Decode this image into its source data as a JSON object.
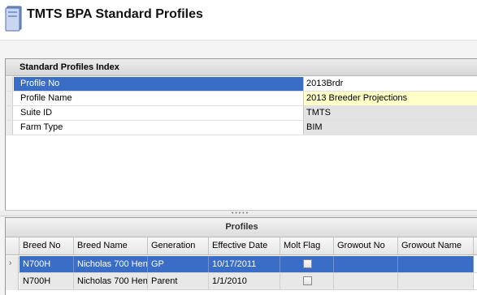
{
  "header": {
    "title": "TMTS BPA Standard Profiles",
    "icon": "profile-book-icon"
  },
  "index": {
    "heading": "Standard Profiles Index",
    "rows": [
      {
        "label": "Profile No",
        "value": "2013Brdr"
      },
      {
        "label": "Profile Name",
        "value": "2013 Breeder Projections"
      },
      {
        "label": "Suite ID",
        "value": "TMTS"
      },
      {
        "label": "Farm Type",
        "value": "BIM"
      }
    ],
    "selected_row": "Profile No"
  },
  "grid": {
    "group_title": "Profiles",
    "columns": [
      "Breed No",
      "Breed Name",
      "Generation",
      "Effective Date",
      "Molt Flag",
      "Growout No",
      "Growout Name"
    ],
    "rows": [
      {
        "breed_no": "N700H",
        "breed_name": "Nicholas 700 Hen",
        "generation": "GP",
        "effective_date": "10/17/2011",
        "molt_flag": false,
        "growout_no": "",
        "growout_name": "",
        "selected": true
      },
      {
        "breed_no": "N700H",
        "breed_name": "Nicholas 700 Hen",
        "generation": "Parent",
        "effective_date": "1/1/2010",
        "molt_flag": false,
        "growout_no": "",
        "growout_name": "",
        "selected": false
      }
    ],
    "current_row_indicator": "›"
  },
  "colors": {
    "selection": "#3a6dc5",
    "editable_value": "#ffffc8",
    "readonly_value": "#e3e3e3"
  }
}
